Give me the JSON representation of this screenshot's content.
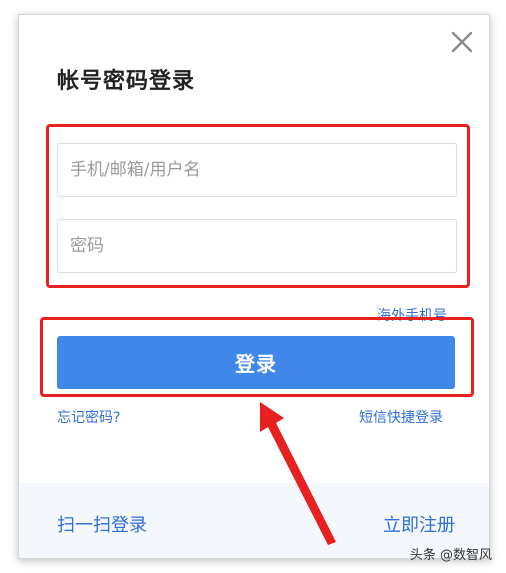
{
  "dialog": {
    "title": "帐号密码登录"
  },
  "form": {
    "username_placeholder": "手机/邮箱/用户名",
    "password_placeholder": "密码",
    "overseas_link": "海外手机号",
    "login_label": "登录",
    "forgot_link": "忘记密码?",
    "sms_link": "短信快捷登录"
  },
  "footer": {
    "scan_link": "扫一扫登录",
    "register_link": "立即注册"
  },
  "watermark": "头条 @数智风",
  "colors": {
    "primary": "#3f88ea",
    "link": "#2f6fd6",
    "annotation": "#e82020",
    "footer_bg": "#f4f8fd"
  },
  "icons": {
    "close": "close-icon",
    "annotation_arrow": "arrow-icon"
  }
}
